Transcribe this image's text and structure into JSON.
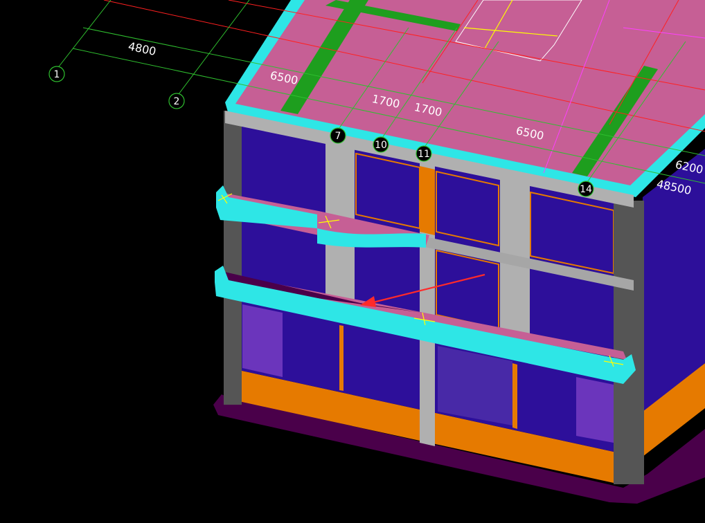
{
  "viewport": {
    "label": "3D model view",
    "colors": {
      "background": "#000000",
      "roof_slab": "#c65f95",
      "slab_edge": "#2ee6e6",
      "glass": "#2d0f9a",
      "wall_orange": "#e67a00",
      "column_gray": "#b0b0b0",
      "beam_green": "#1e9e1e",
      "plinth": "#4a004a",
      "grid_line": "#2fbf2f",
      "axis_line": "#ff2020"
    }
  },
  "dimensions": {
    "d1": "4800",
    "d2": "6500",
    "d3": "1700",
    "d4": "1700",
    "d5": "6500",
    "d6": "6200",
    "d7": "48500"
  },
  "axes": {
    "a1": "1",
    "a2": "2",
    "a7": "7",
    "a10": "10",
    "a11": "11",
    "a14": "14"
  },
  "annotation": {
    "arrow_icon": "red-arrow-icon"
  }
}
